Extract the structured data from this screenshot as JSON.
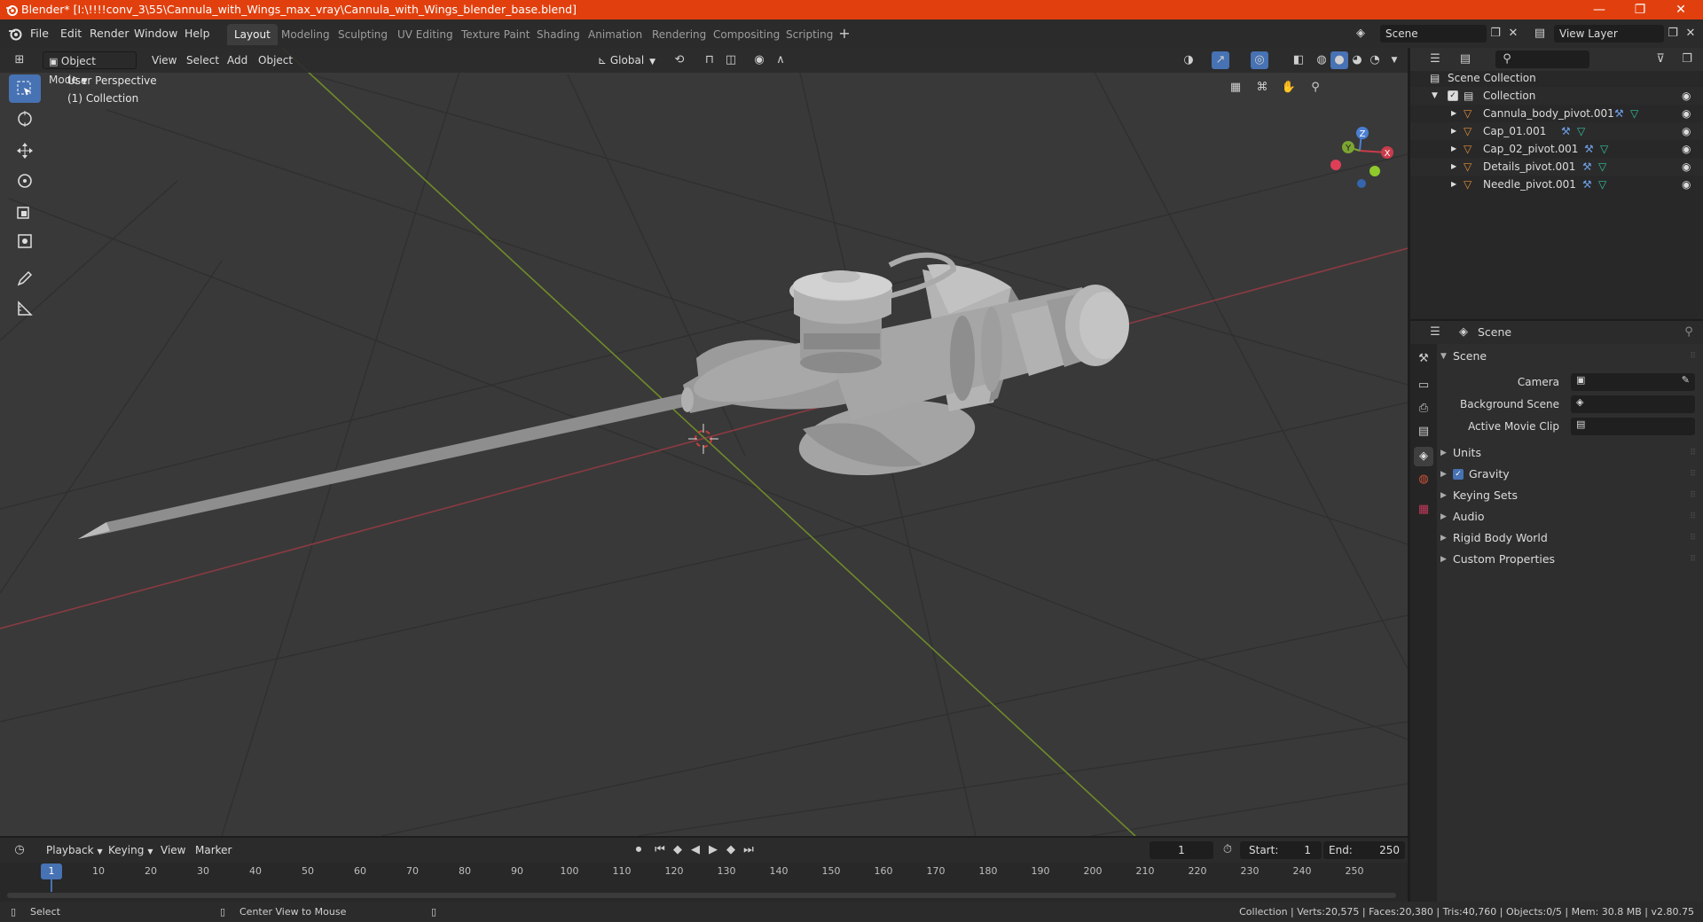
{
  "window": {
    "title": "Blender* [I:\\!!!!conv_3\\55\\Cannula_with_Wings_max_vray\\Cannula_with_Wings_blender_base.blend]",
    "controls": [
      "—",
      "❐",
      "✕"
    ]
  },
  "menu": [
    "File",
    "Edit",
    "Render",
    "Window",
    "Help"
  ],
  "workspaces": [
    {
      "label": "Layout",
      "active": true
    },
    {
      "label": "Modeling"
    },
    {
      "label": "Sculpting"
    },
    {
      "label": "UV Editing"
    },
    {
      "label": "Texture Paint"
    },
    {
      "label": "Shading"
    },
    {
      "label": "Animation"
    },
    {
      "label": "Rendering"
    },
    {
      "label": "Compositing"
    },
    {
      "label": "Scripting"
    }
  ],
  "scene_field": "Scene",
  "view_layer_field": "View Layer",
  "viewport": {
    "mode": "Object Mode",
    "menus": [
      "View",
      "Select",
      "Add",
      "Object"
    ],
    "orientation": "Global",
    "perspective_label": "User Perspective",
    "collection_label": "(1) Collection",
    "gizmo_axes": {
      "x": "X",
      "y": "Y",
      "z": "Z"
    }
  },
  "outliner": {
    "root": "Scene Collection",
    "collection": "Collection",
    "objects": [
      "Cannula_body_pivot.001",
      "Cap_01.001",
      "Cap_02_pivot.001",
      "Details_pivot.001",
      "Needle_pivot.001"
    ]
  },
  "properties": {
    "context": "Scene",
    "section": "Scene",
    "fields": {
      "camera": "Camera",
      "background_scene": "Background Scene",
      "active_movie_clip": "Active Movie Clip"
    },
    "panels": [
      "Units",
      "Gravity",
      "Keying Sets",
      "Audio",
      "Rigid Body World",
      "Custom Properties"
    ]
  },
  "timeline": {
    "menus": [
      "Playback",
      "Keying",
      "View",
      "Marker"
    ],
    "current_frame": "1",
    "start_label": "Start:",
    "start": "1",
    "end_label": "End:",
    "end": "250",
    "ticks": [
      "1",
      "10",
      "20",
      "30",
      "40",
      "50",
      "60",
      "70",
      "80",
      "90",
      "100",
      "110",
      "120",
      "130",
      "140",
      "150",
      "160",
      "170",
      "180",
      "190",
      "200",
      "210",
      "220",
      "230",
      "240",
      "250"
    ]
  },
  "status": {
    "select": "Select",
    "center_view": "Center View to Mouse",
    "stats": "Collection | Verts:20,575 | Faces:20,380 | Tris:40,760 | Objects:0/5 | Mem: 30.8 MB | v2.80.75"
  },
  "colors": {
    "accent": "#4772b3",
    "titlebar": "#e1400e",
    "x_axis": "#c0394a",
    "y_axis": "#8cad25",
    "object_icon": "#e98f3a"
  }
}
